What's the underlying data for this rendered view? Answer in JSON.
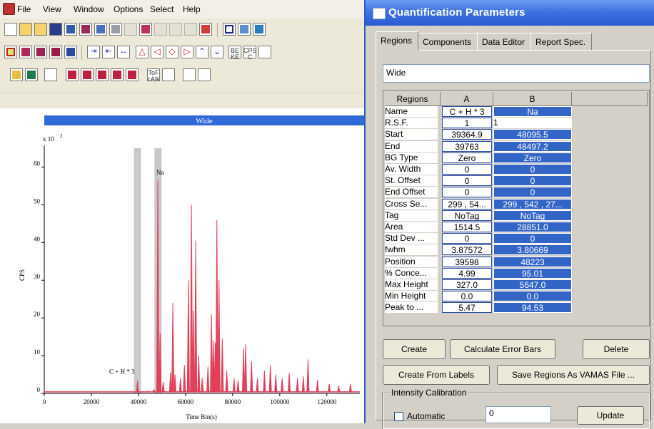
{
  "menu": {
    "items": [
      "File",
      "View",
      "Window",
      "Options",
      "Select",
      "Help"
    ]
  },
  "toolbars": {
    "row3_labels": [
      "ToF cAlk",
      "CPS C",
      "BE KE"
    ]
  },
  "plot": {
    "banner": "Wide",
    "y_multiplier": "x 10",
    "y_exp": "2",
    "ylabel": "CPS",
    "xlabel": "Time Bin(s)",
    "peak_labels": [
      "Na",
      "C + H * 3"
    ],
    "colors": {
      "spectrum": "#e0405a",
      "banner": "#2f6ad8",
      "region": "#c8c8c8"
    }
  },
  "chart_data": {
    "type": "line",
    "title": "Wide",
    "xlabel": "Time Bin(s)",
    "ylabel": "CPS",
    "x_ticks": [
      0,
      20000,
      40000,
      60000,
      80000,
      100000,
      120000
    ],
    "y_ticks": [
      0,
      10,
      20,
      30,
      40,
      50,
      60
    ],
    "y_tick_labels": [
      "0",
      "10",
      "20",
      "30",
      "40",
      "50",
      "60"
    ],
    "xlim": [
      0,
      134000
    ],
    "ylim": [
      0,
      65
    ],
    "y_scale_note": "x 10^2",
    "regions": [
      {
        "name": "C + H * 3",
        "start": 39364.9,
        "end": 39763
      },
      {
        "name": "Na",
        "start": 48095.5,
        "end": 48497.2
      }
    ],
    "peaks": [
      {
        "x": 39598,
        "y": 3.3
      },
      {
        "x": 43800,
        "y": 0.6
      },
      {
        "x": 46500,
        "y": 1.0
      },
      {
        "x": 48223,
        "y": 56.5
      },
      {
        "x": 49200,
        "y": 16.0
      },
      {
        "x": 50500,
        "y": 3.0
      },
      {
        "x": 53600,
        "y": 5.5
      },
      {
        "x": 54600,
        "y": 24.0
      },
      {
        "x": 55500,
        "y": 5.0
      },
      {
        "x": 57800,
        "y": 4.0
      },
      {
        "x": 59500,
        "y": 7.5
      },
      {
        "x": 61200,
        "y": 30.0
      },
      {
        "x": 62500,
        "y": 50.0
      },
      {
        "x": 63300,
        "y": 22.0
      },
      {
        "x": 64300,
        "y": 40.5
      },
      {
        "x": 65600,
        "y": 10.0
      },
      {
        "x": 67100,
        "y": 4.0
      },
      {
        "x": 69500,
        "y": 7.0
      },
      {
        "x": 71000,
        "y": 21.0
      },
      {
        "x": 71800,
        "y": 14.0
      },
      {
        "x": 72600,
        "y": 13.5
      },
      {
        "x": 73300,
        "y": 46.0
      },
      {
        "x": 74200,
        "y": 30.0
      },
      {
        "x": 75600,
        "y": 14.5
      },
      {
        "x": 77500,
        "y": 6.0
      },
      {
        "x": 80600,
        "y": 4.0
      },
      {
        "x": 82300,
        "y": 3.5
      },
      {
        "x": 84600,
        "y": 12.0
      },
      {
        "x": 85500,
        "y": 13.0
      },
      {
        "x": 88000,
        "y": 8.5
      },
      {
        "x": 90500,
        "y": 4.0
      },
      {
        "x": 93500,
        "y": 6.0
      },
      {
        "x": 96000,
        "y": 7.5
      },
      {
        "x": 98300,
        "y": 5.0
      },
      {
        "x": 101000,
        "y": 4.0
      },
      {
        "x": 104000,
        "y": 5.5
      },
      {
        "x": 107500,
        "y": 4.0
      },
      {
        "x": 110000,
        "y": 4.5
      },
      {
        "x": 112000,
        "y": 9.0
      },
      {
        "x": 116000,
        "y": 3.5
      },
      {
        "x": 121000,
        "y": 2.5
      },
      {
        "x": 125000,
        "y": 2.0
      },
      {
        "x": 130000,
        "y": 2.5
      }
    ]
  },
  "dialog": {
    "title": "Quantification Parameters",
    "tabs": [
      "Regions",
      "Components",
      "Data Editor",
      "Report Spec."
    ],
    "name_value": "Wide",
    "grid": {
      "headers": [
        "Regions",
        "A",
        "B"
      ],
      "rows": [
        {
          "label": "Name",
          "a": "C + H * 3",
          "b": "Na"
        },
        {
          "label": "R.S.F.",
          "a": "1",
          "b": "1"
        },
        {
          "label": "Start",
          "a": "39364.9",
          "b": "48095.5"
        },
        {
          "label": "End",
          "a": "39763",
          "b": "48497.2"
        },
        {
          "label": "BG Type",
          "a": "Zero",
          "b": "Zero"
        },
        {
          "label": "Av. Width",
          "a": "0",
          "b": "0"
        },
        {
          "label": "St. Offset",
          "a": "0",
          "b": "0"
        },
        {
          "label": "End Offset",
          "a": "0",
          "b": "0"
        },
        {
          "label": "Cross Se...",
          "a": "299 , 54...",
          "b": "299 , 542 , 27..."
        },
        {
          "label": "Tag",
          "a": "NoTag",
          "b": "NoTag"
        },
        {
          "label": "Area",
          "a": "1514.5",
          "b": "28851.0"
        },
        {
          "label": "Std Dev ...",
          "a": "0",
          "b": "0"
        },
        {
          "label": "fwhm",
          "a": "3.87572",
          "b": "3.80669"
        },
        {
          "label": "Position",
          "a": "39598",
          "b": "48223"
        },
        {
          "label": "% Conce...",
          "a": "4.99",
          "b": "95.01"
        },
        {
          "label": "Max Height",
          "a": "327.0",
          "b": "5647.0"
        },
        {
          "label": "Min Height",
          "a": "0.0",
          "b": "0.0"
        },
        {
          "label": "Peak to ...",
          "a": "5.47",
          "b": "94.53"
        }
      ]
    },
    "buttons": {
      "create": "Create",
      "calc_error": "Calculate Error Bars",
      "delete": "Delete",
      "create_from_labels": "Create From Labels",
      "save_vamas": "Save Regions As VAMAS File ...",
      "update": "Update"
    },
    "intensity": {
      "group_label": "Intensity Calibration",
      "automatic_label": "Automatic",
      "value": "0"
    }
  }
}
